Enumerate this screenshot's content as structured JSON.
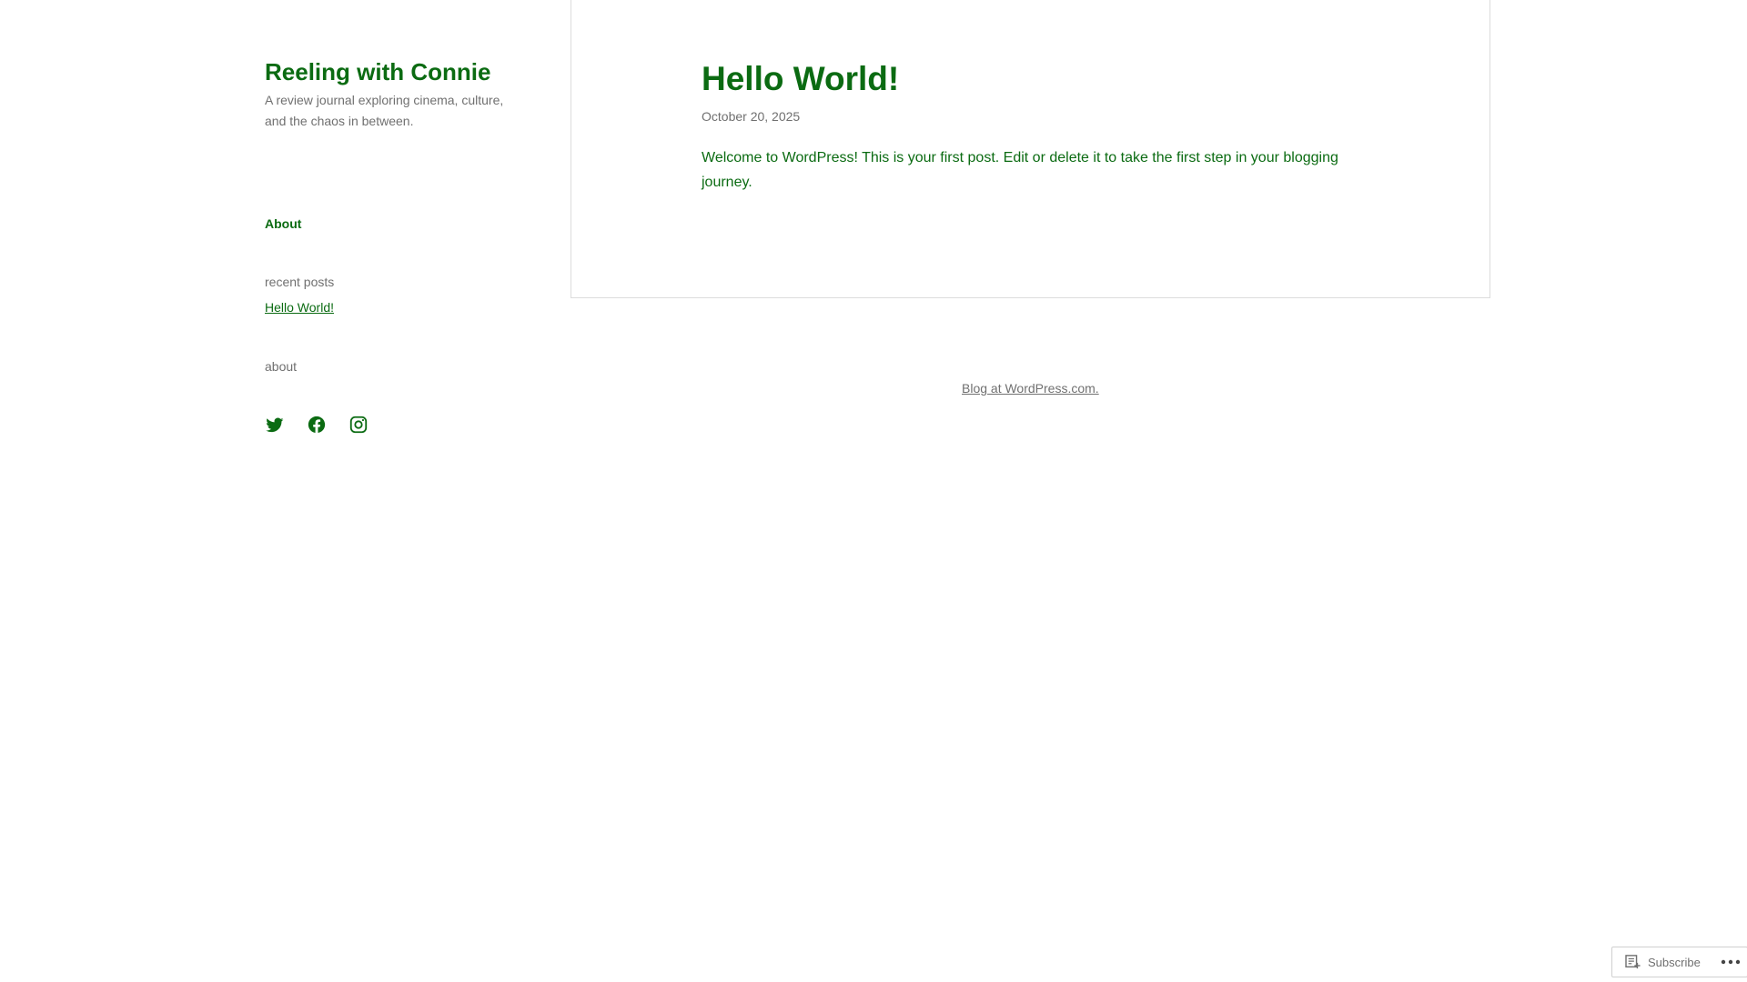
{
  "site": {
    "title": "Reeling with Connie",
    "description": "A review journal exploring cinema, culture, and the chaos in between."
  },
  "navigation": {
    "about_label": "About"
  },
  "widgets": {
    "recent_posts_title": "recent posts",
    "recent_posts": [
      "Hello World!"
    ],
    "about_title": "about"
  },
  "social": {
    "icons": [
      "twitter-icon",
      "facebook-icon",
      "instagram-icon"
    ]
  },
  "post": {
    "title": "Hello World!",
    "date": "October 20, 2025",
    "body": "Welcome to WordPress! This is your first post. Edit or delete it to take the first step in your blogging journey."
  },
  "footer": {
    "credit": "Blog at WordPress.com."
  },
  "actionbar": {
    "subscribe_label": "Subscribe"
  },
  "colors": {
    "accent": "#0b6b12",
    "muted_text": "#707070",
    "border": "#dcdcdc"
  }
}
